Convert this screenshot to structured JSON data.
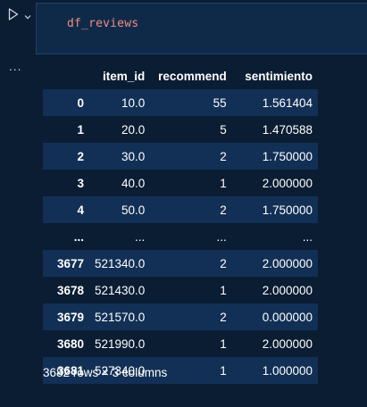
{
  "cell": {
    "code": "df_reviews",
    "output_collapse": "..."
  },
  "table": {
    "columns": [
      "",
      "item_id",
      "recommend",
      "sentimiento"
    ],
    "rows": [
      [
        "0",
        "10.0",
        "55",
        "1.561404"
      ],
      [
        "1",
        "20.0",
        "5",
        "1.470588"
      ],
      [
        "2",
        "30.0",
        "2",
        "1.750000"
      ],
      [
        "3",
        "40.0",
        "1",
        "2.000000"
      ],
      [
        "4",
        "50.0",
        "2",
        "1.750000"
      ],
      [
        "...",
        "...",
        "...",
        "..."
      ],
      [
        "3677",
        "521340.0",
        "2",
        "2.000000"
      ],
      [
        "3678",
        "521430.0",
        "1",
        "2.000000"
      ],
      [
        "3679",
        "521570.0",
        "2",
        "0.000000"
      ],
      [
        "3680",
        "521990.0",
        "1",
        "2.000000"
      ],
      [
        "3681",
        "527340.0",
        "1",
        "1.000000"
      ]
    ]
  },
  "summary": "3682 rows × 3 columns",
  "colors": {
    "background": "#0a1d33",
    "code_background": "#0f2a49",
    "row_stripe": "#123055",
    "code_text": "#f28b82"
  },
  "icons": {
    "run": "play-icon",
    "expand": "chevron-down-icon"
  }
}
